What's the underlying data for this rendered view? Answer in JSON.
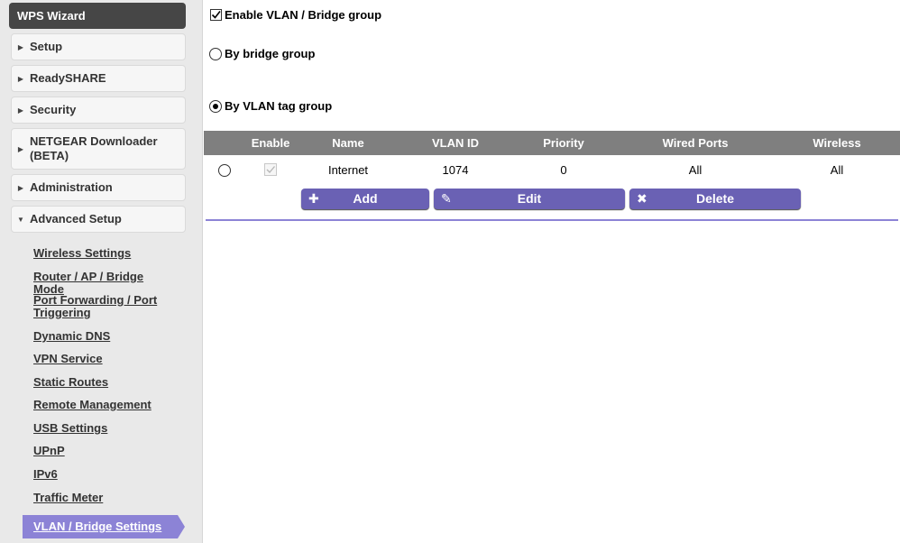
{
  "sidebar": {
    "wps_wizard": "WPS Wizard",
    "items": [
      {
        "label": "Setup"
      },
      {
        "label": "ReadySHARE"
      },
      {
        "label": "Security"
      },
      {
        "label": "NETGEAR Downloader (BETA)"
      },
      {
        "label": "Administration"
      },
      {
        "label": "Advanced Setup"
      }
    ],
    "advanced_links": [
      "Wireless Settings",
      "Router / AP / Bridge Mode",
      "Port Forwarding / Port Triggering",
      "Dynamic DNS",
      "VPN Service",
      "Static Routes",
      "Remote Management",
      "USB Settings",
      "UPnP",
      "IPv6",
      "Traffic Meter"
    ],
    "active_link": "VLAN / Bridge Settings"
  },
  "main": {
    "enable_label": "Enable VLAN / Bridge group",
    "enable_checked": true,
    "by_bridge_label": "By bridge group",
    "by_vlan_label": "By VLAN tag group",
    "selected_mode": "By VLAN tag group",
    "table": {
      "headers": [
        "Enable",
        "Name",
        "VLAN ID",
        "Priority",
        "Wired Ports",
        "Wireless"
      ],
      "rows": [
        {
          "enable": true,
          "name": "Internet",
          "vlan_id": "1074",
          "priority": "0",
          "wired_ports": "All",
          "wireless": "All"
        }
      ]
    },
    "buttons": {
      "add": "Add",
      "edit": "Edit",
      "delete": "Delete"
    }
  },
  "colors": {
    "accent": "#6a61b4",
    "active_tab": "#8c83d6",
    "header_bg": "#7f7f7f",
    "sidebar_bg": "#e9e9e9"
  }
}
